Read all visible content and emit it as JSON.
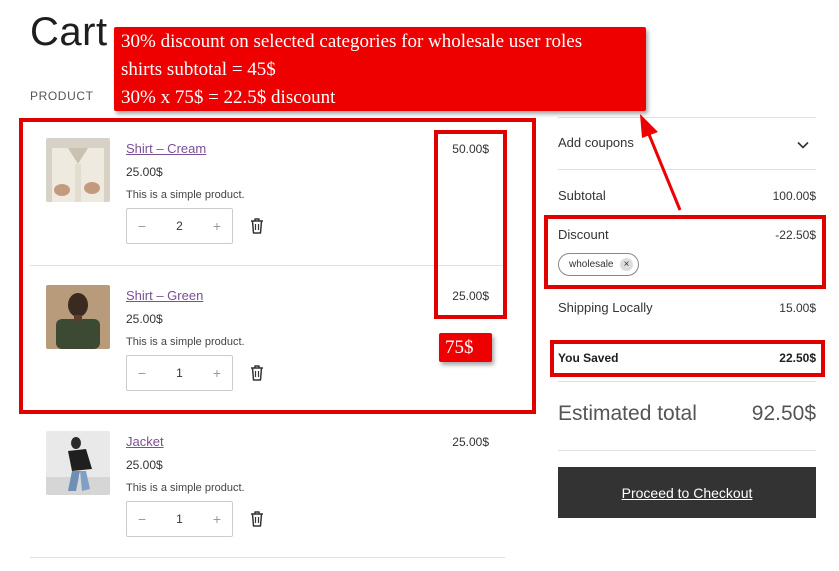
{
  "page": {
    "title": "Cart",
    "column_header": "PRODUCT"
  },
  "items": [
    {
      "name": "Shirt – Cream",
      "unit_price": "25.00$",
      "description": "This is a simple product.",
      "quantity": "2",
      "line_total": "50.00$",
      "image": "cream-shirt-photo"
    },
    {
      "name": "Shirt – Green",
      "unit_price": "25.00$",
      "description": "This is a simple product.",
      "quantity": "1",
      "line_total": "25.00$",
      "image": "green-shirt-photo"
    },
    {
      "name": "Jacket",
      "unit_price": "25.00$",
      "description": "This is a simple product.",
      "quantity": "1",
      "line_total": "25.00$",
      "image": "jacket-photo"
    }
  ],
  "qty": {
    "minus": "−",
    "plus": "+"
  },
  "totals": {
    "coupons_label": "Add coupons",
    "subtotal_label": "Subtotal",
    "subtotal_value": "100.00$",
    "discount_label": "Discount",
    "discount_value": "-22.50$",
    "coupon_code": "wholesale",
    "coupon_remove": "×",
    "shipping_label": "Shipping Locally",
    "shipping_value": "15.00$",
    "saved_label": "You Saved",
    "saved_value": "22.50$",
    "estimated_label": "Estimated total",
    "estimated_value": "92.50$",
    "checkout_label": "Proceed to Checkout"
  },
  "annotations": {
    "callout_lines": [
      "30% discount on selected categories for wholesale user roles",
      "shirts subtotal = 45$",
      "30% x 75$ = 22.5$ discount"
    ],
    "tag": "75$"
  },
  "colors": {
    "accent_red": "#ee0000",
    "link_purple": "#7b4f95",
    "checkout_bg": "#333333"
  }
}
